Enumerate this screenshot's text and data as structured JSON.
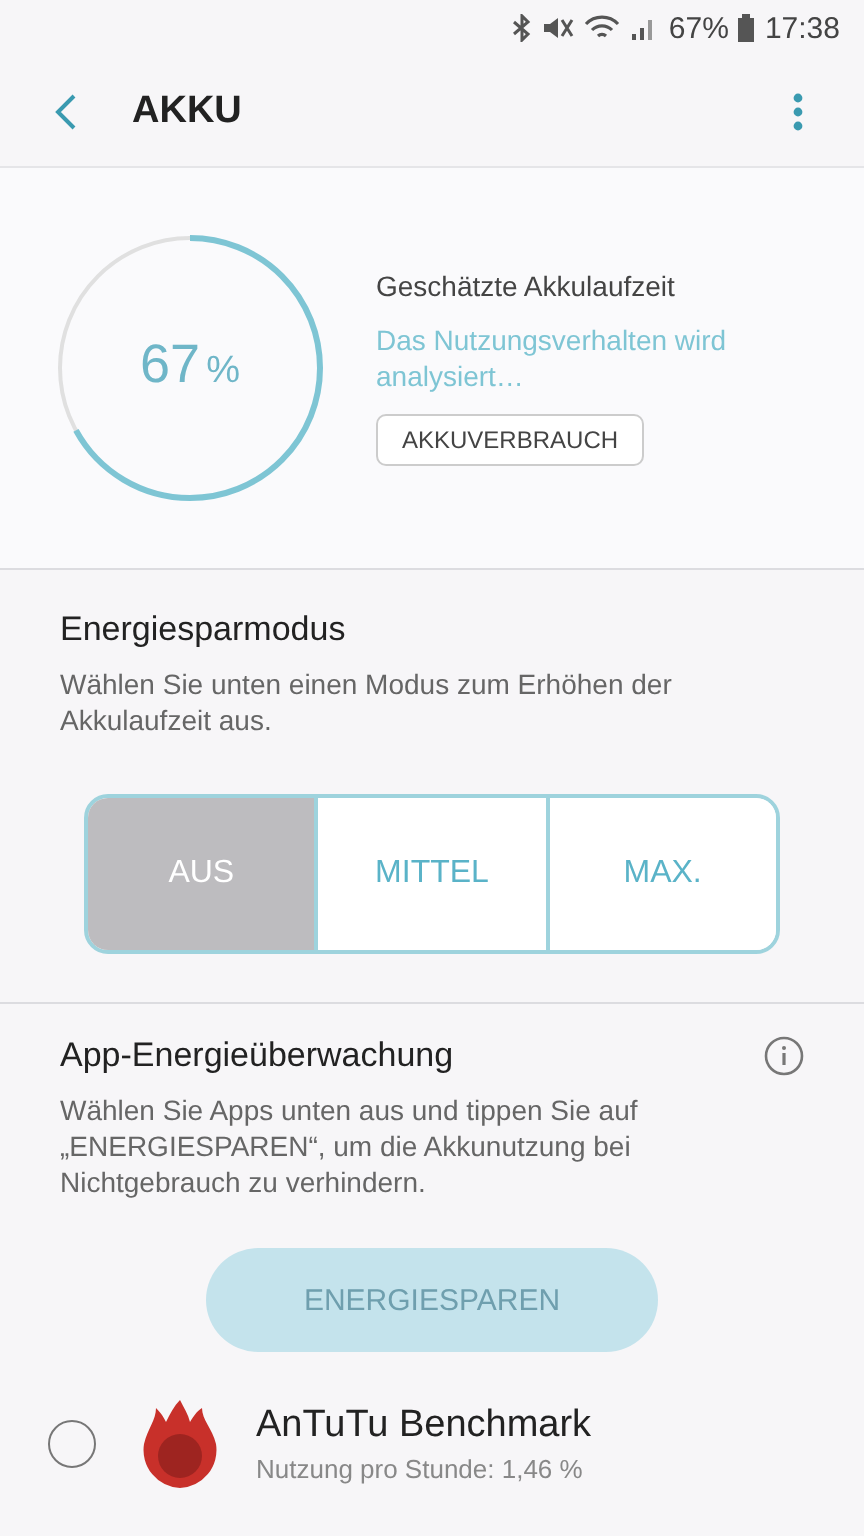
{
  "status_bar": {
    "battery": "67%",
    "time": "17:38"
  },
  "header": {
    "title": "AKKU"
  },
  "battery": {
    "level": 0.67,
    "percent": "67",
    "unit": "%",
    "label": "Geschätzte Akkulaufzeit",
    "status": "Das Nutzungsverhalten wird analysiert…",
    "button": "AKKUVERBRAUCH"
  },
  "power_saving": {
    "title": "Energiesparmodus",
    "description": "Wählen Sie unten einen Modus zum Erhöhen der Akkulaufzeit aus.",
    "modes": [
      {
        "label": "AUS",
        "selected": true
      },
      {
        "label": "MITTEL",
        "selected": false
      },
      {
        "label": "MAX.",
        "selected": false
      }
    ]
  },
  "app_monitor": {
    "title": "App-Energieüberwachung",
    "description": "Wählen Sie Apps unten aus und tippen Sie auf „ENERGIESPAREN“, um die Akkunutzung bei Nichtgebrauch zu verhindern.",
    "button": {
      "label": "ENERGIESPAREN",
      "disabled": true
    },
    "apps": [
      {
        "name": "AnTuTu Benchmark",
        "usage": "Nutzung pro Stunde: 1,46 %",
        "checked": false
      }
    ]
  }
}
